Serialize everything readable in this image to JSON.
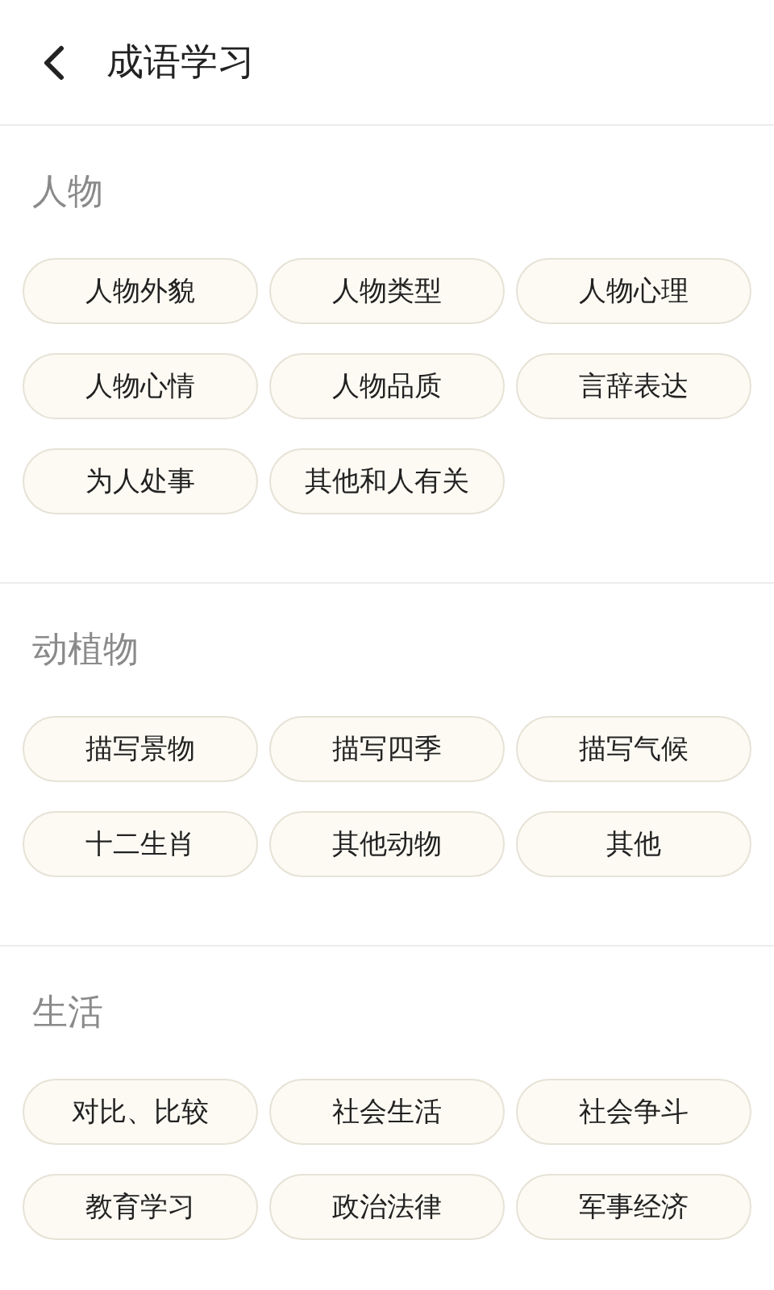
{
  "header": {
    "title": "成语学习"
  },
  "sections": [
    {
      "title": "人物",
      "tags": [
        "人物外貌",
        "人物类型",
        "人物心理",
        "人物心情",
        "人物品质",
        "言辞表达",
        "为人处事",
        "其他和人有关"
      ]
    },
    {
      "title": "动植物",
      "tags": [
        "描写景物",
        "描写四季",
        "描写气候",
        "十二生肖",
        "其他动物",
        "其他"
      ]
    },
    {
      "title": "生活",
      "tags": [
        "对比、比较",
        "社会生活",
        "社会争斗",
        "教育学习",
        "政治法律",
        "军事经济"
      ]
    }
  ]
}
